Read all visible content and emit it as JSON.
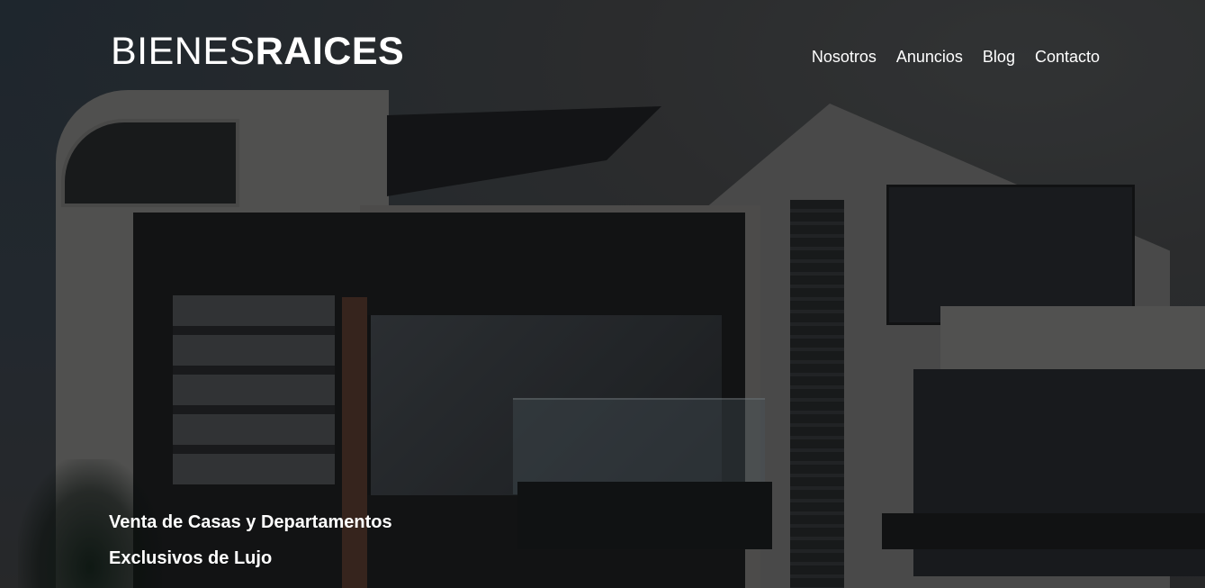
{
  "header": {
    "logo": {
      "light": "BIENES",
      "bold": "RAICES"
    },
    "nav": [
      {
        "label": "Nosotros"
      },
      {
        "label": "Anuncios"
      },
      {
        "label": "Blog"
      },
      {
        "label": "Contacto"
      }
    ]
  },
  "hero": {
    "line1": "Venta de Casas y Departamentos",
    "line2": "Exclusivos de Lujo"
  },
  "colors": {
    "text": "#ffffff",
    "overlay": "#000000"
  }
}
